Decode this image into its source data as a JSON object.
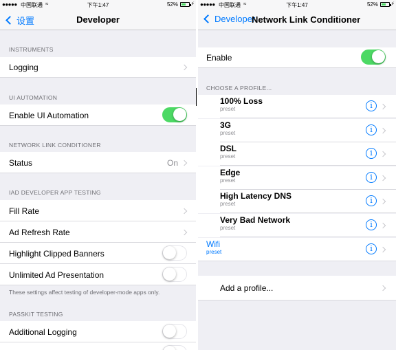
{
  "status_bar": {
    "signal": "●●●●●",
    "carrier": "中国联通",
    "wifi_icon": "wifi-icon",
    "time": "下午1:47",
    "battery_percent": "52%",
    "battery_level": 0.52
  },
  "left": {
    "back_label": "设置",
    "title": "Developer",
    "sections": {
      "instruments": {
        "header": "INSTRUMENTS",
        "logging": "Logging"
      },
      "ui_automation": {
        "header": "UI AUTOMATION",
        "enable_ui_automation": "Enable UI Automation",
        "enable_ui_automation_on": true
      },
      "network": {
        "header": "NETWORK LINK CONDITIONER",
        "status": "Status",
        "status_value": "On"
      },
      "iad": {
        "header": "IAD DEVELOPER APP TESTING",
        "fill_rate": "Fill Rate",
        "ad_refresh_rate": "Ad Refresh Rate",
        "highlight_clipped": "Highlight Clipped Banners",
        "unlimited_ad": "Unlimited Ad Presentation",
        "footer": "These settings affect testing of developer-mode apps only."
      },
      "passkit": {
        "header": "PASSKIT TESTING",
        "additional_logging": "Additional Logging"
      }
    }
  },
  "right": {
    "back_label": "Developer",
    "title": "Network Link Conditioner",
    "enable_label": "Enable",
    "enable_on": true,
    "profiles_header": "CHOOSE A PROFILE...",
    "profiles": [
      {
        "name": "100% Loss",
        "sub": "preset"
      },
      {
        "name": "3G",
        "sub": "preset"
      },
      {
        "name": "DSL",
        "sub": "preset"
      },
      {
        "name": "Edge",
        "sub": "preset"
      },
      {
        "name": "High Latency DNS",
        "sub": "preset"
      },
      {
        "name": "Very Bad Network",
        "sub": "preset"
      },
      {
        "name": "Wifi",
        "sub": "preset"
      }
    ],
    "selected_profile": "Wifi",
    "add_profile": "Add a profile...",
    "info_glyph": "i"
  },
  "colors": {
    "accent": "#007aff",
    "toggle_on": "#4cd964",
    "background": "#efeff4"
  }
}
